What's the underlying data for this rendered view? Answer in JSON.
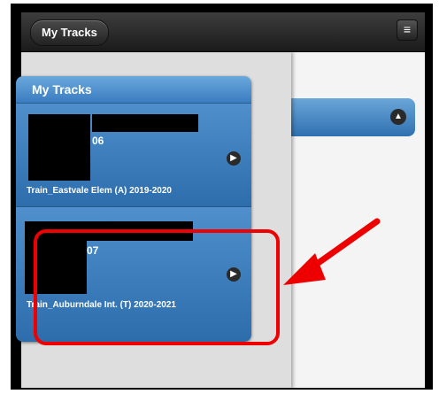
{
  "header": {
    "back_label": "My Tracks",
    "menu_icon": "menu-icon"
  },
  "list": {
    "title": "My Tracks",
    "items": [
      {
        "partial_text": "06",
        "train_label": "Train_Eastvale Elem (A)  2019-2020"
      },
      {
        "partial_text": "07",
        "train_label": "Train_Auburndale Int. (T)  2020-2021"
      }
    ]
  },
  "colors": {
    "accent": "#3a7cc0",
    "highlight": "#ee0000",
    "header_dark": "#1b1b1b"
  }
}
